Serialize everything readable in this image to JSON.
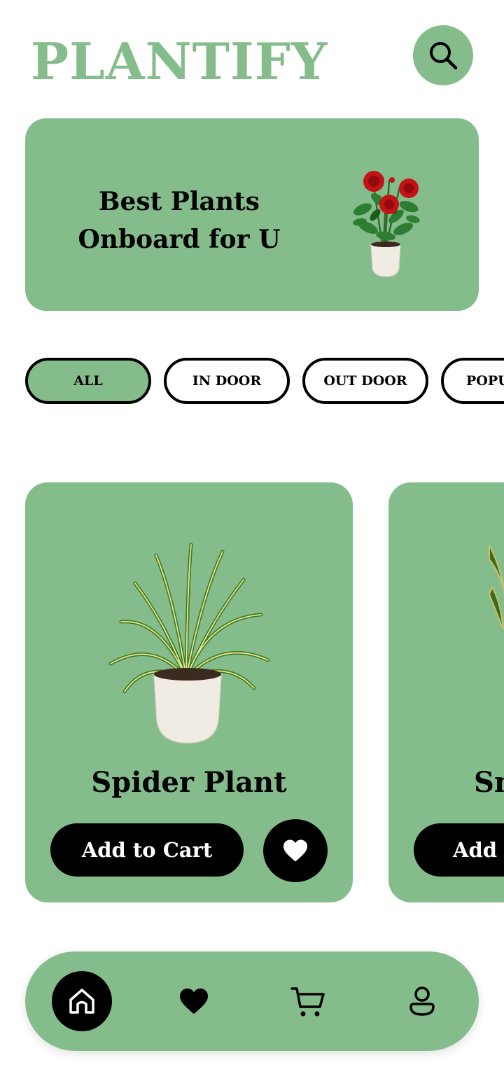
{
  "app": {
    "logo": "PLANTIFY"
  },
  "header": {
    "search_icon": "search-icon"
  },
  "banner": {
    "line1": "Best Plants",
    "line2": "Onboard for U",
    "image": "rose-pot-illustration"
  },
  "categories": [
    {
      "label": "ALL",
      "active": true
    },
    {
      "label": "IN DOOR",
      "active": false
    },
    {
      "label": "OUT DOOR",
      "active": false
    },
    {
      "label": "POPU",
      "active": false
    }
  ],
  "products": [
    {
      "name": "Spider Plant",
      "add_label": "Add to Cart",
      "image": "spider-plant-illustration"
    },
    {
      "name": "Sn",
      "add_label": "Add t",
      "image": "snake-plant-illustration"
    }
  ],
  "bottom_nav": {
    "items": [
      {
        "icon": "home-icon",
        "active": true
      },
      {
        "icon": "heart-icon",
        "active": false
      },
      {
        "icon": "cart-icon",
        "active": false
      },
      {
        "icon": "profile-icon",
        "active": false
      }
    ]
  },
  "colors": {
    "accent": "#84BD8B",
    "black": "#000000",
    "background": "#FFFFFF"
  }
}
